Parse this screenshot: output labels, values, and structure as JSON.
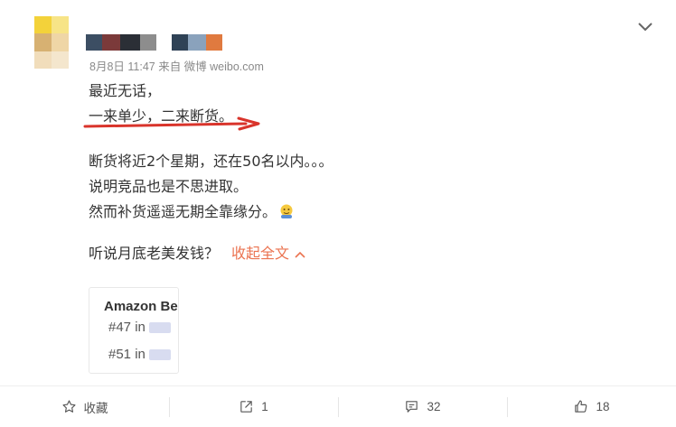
{
  "post": {
    "meta": "8月8日 11:47 来自 微博 weibo.com",
    "lines": [
      "最近无话，",
      "一来单少，二来断货。",
      "断货将近2个星期，还在50名以内。。。",
      "说明竞品也是不思进取。",
      "然而补货遥遥无期全靠缘分。",
      "听说月底老美发钱？"
    ],
    "collapse_label": "收起全文"
  },
  "card": {
    "title": "Amazon Be",
    "rank1": "#47 in",
    "rank2": "#51 in"
  },
  "actions": {
    "favorite": "收藏",
    "repost": "1",
    "comment": "32",
    "like": "18"
  },
  "colors": {
    "accent": "#eb7350",
    "arrow": "#d9342b"
  }
}
